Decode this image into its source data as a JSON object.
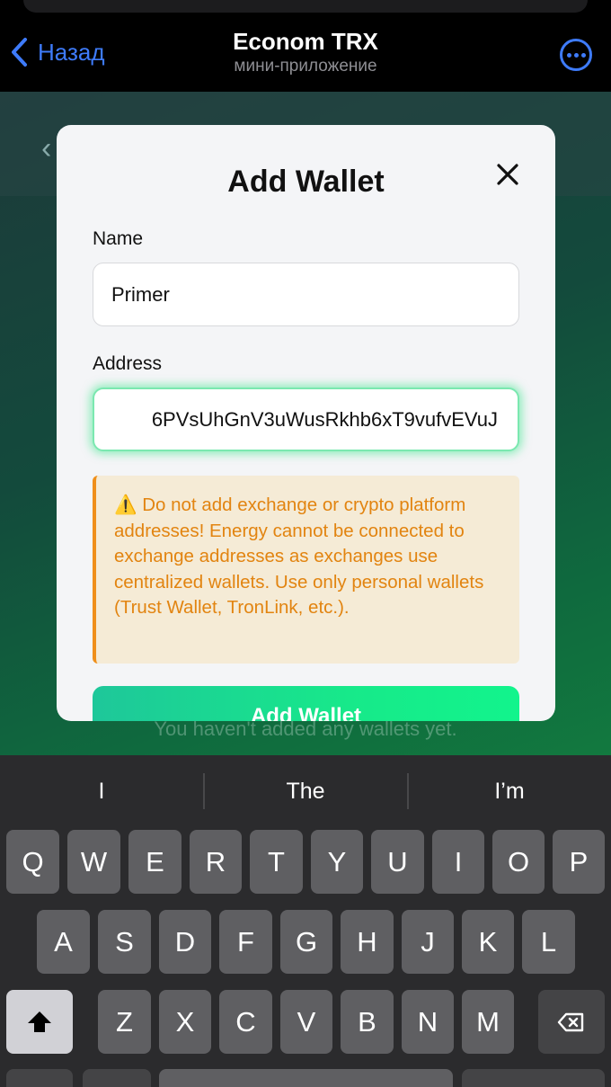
{
  "topbar": {
    "back_label": "Назад",
    "title": "Econom TRX",
    "subtitle": "мини-приложение",
    "accent_color": "#3e7bfa"
  },
  "app": {
    "empty_text": "You haven't added any wallets yet."
  },
  "modal": {
    "title": "Add Wallet",
    "name_label": "Name",
    "name_value": "Primer",
    "address_label": "Address",
    "address_value": "6PVsUhGnV3uWusRkhb6xT9vufvEVuJ",
    "warning_text": "⚠️ Do not add exchange or crypto platform addresses! Energy cannot be connected to exchange addresses as exchanges use centralized wallets. Use only personal wallets (Trust Wallet, TronLink, etc.).",
    "submit_label": "Add Wallet"
  },
  "keyboard": {
    "suggestions": [
      "I",
      "The",
      "I’m"
    ],
    "row1": [
      "Q",
      "W",
      "E",
      "R",
      "T",
      "Y",
      "U",
      "I",
      "O",
      "P"
    ],
    "row2": [
      "A",
      "S",
      "D",
      "F",
      "G",
      "H",
      "J",
      "K",
      "L"
    ],
    "row3": [
      "Z",
      "X",
      "C",
      "V",
      "B",
      "N",
      "M"
    ],
    "shift_icon": "shift-arrow-icon",
    "delete_icon": "backspace-icon"
  }
}
